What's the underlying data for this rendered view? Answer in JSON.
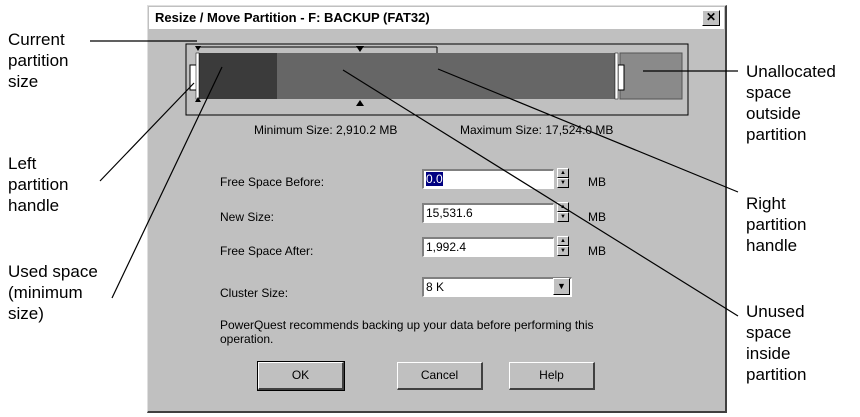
{
  "callouts": {
    "current_partition_size": [
      "Current",
      "partition",
      "size"
    ],
    "left_partition_handle": [
      "Left",
      "partition",
      "handle"
    ],
    "used_space": [
      "Used space",
      "(minimum",
      "size)"
    ],
    "unallocated_space": [
      "Unallocated",
      "space",
      "outside",
      "partition"
    ],
    "right_partition_handle": [
      "Right",
      "partition",
      "handle"
    ],
    "unused_space": [
      "Unused",
      "space",
      "inside",
      "partition"
    ]
  },
  "dialog": {
    "title": "Resize / Move Partition - F: BACKUP (FAT32)",
    "close_glyph": "✕",
    "minimum_size_label": "Minimum Size:",
    "minimum_size_value": "2,910.2 MB",
    "maximum_size_label": "Maximum Size:",
    "maximum_size_value": "17,524.0 MB",
    "fields": {
      "free_space_before": {
        "label": "Free Space Before:",
        "value": "0.0",
        "unit": "MB"
      },
      "new_size": {
        "label": "New Size:",
        "value": "15,531.6",
        "unit": "MB"
      },
      "free_space_after": {
        "label": "Free Space After:",
        "value": "1,992.4",
        "unit": "MB"
      },
      "cluster_size": {
        "label": "Cluster Size:",
        "value": "8 K"
      }
    },
    "note": "PowerQuest recommends backing up your data before performing this operation.",
    "buttons": {
      "ok": "OK",
      "cancel": "Cancel",
      "help": "Help"
    }
  },
  "colors": {
    "dialog_bg": "#c0c0c0",
    "used_space": "#3b3b3b",
    "unused_space": "#666666",
    "unallocated": "#8a8a8a"
  }
}
